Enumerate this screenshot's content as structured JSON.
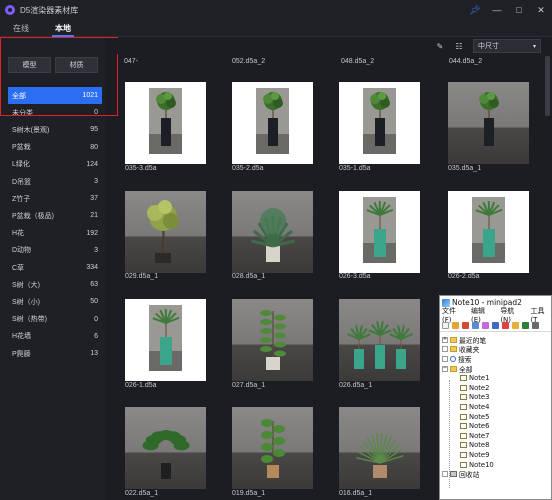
{
  "app": {
    "title": "D5渲染器素材库"
  },
  "tabs": [
    "在线",
    "本地"
  ],
  "type_buttons": [
    "模型",
    "材质"
  ],
  "categories": [
    {
      "label": "全部",
      "count": "1021"
    },
    {
      "label": "未分类",
      "count": "0"
    },
    {
      "label": "S树木(景观)",
      "count": "95"
    },
    {
      "label": "P盆栽",
      "count": "80"
    },
    {
      "label": "L绿化",
      "count": "124"
    },
    {
      "label": "D吊篮",
      "count": "3"
    },
    {
      "label": "Z竹子",
      "count": "37"
    },
    {
      "label": "P盆栽（极品)",
      "count": "21"
    },
    {
      "label": "H花",
      "count": "192"
    },
    {
      "label": "D动物",
      "count": "3"
    },
    {
      "label": "C草",
      "count": "334"
    },
    {
      "label": "S树（大)",
      "count": "63"
    },
    {
      "label": "S树（小)",
      "count": "50"
    },
    {
      "label": "S树（热带)",
      "count": "0"
    },
    {
      "label": "H花墙",
      "count": "6"
    },
    {
      "label": "P爬藤",
      "count": "13"
    }
  ],
  "toolbar": {
    "size_select": "中尺寸"
  },
  "top_labels": [
    "047-",
    "052.d5a_2",
    "048.d5a_2",
    "044.d5a_2"
  ],
  "items": [
    {
      "label": "035-3.d5a",
      "bg": "white",
      "plant": "topiary"
    },
    {
      "label": "035-2.d5a",
      "bg": "white",
      "plant": "topiary"
    },
    {
      "label": "035-1.d5a",
      "bg": "white",
      "plant": "topiary"
    },
    {
      "label": "035.d5a_1",
      "bg": "concrete",
      "plant": "topiary"
    },
    {
      "label": "029.d5a_1",
      "bg": "concrete",
      "plant": "bonsai"
    },
    {
      "label": "028.d5a_1",
      "bg": "concrete",
      "plant": "fern"
    },
    {
      "label": "026-3.d5a",
      "bg": "white",
      "plant": "palm"
    },
    {
      "label": "026-2.d5a",
      "bg": "white",
      "plant": "palm"
    },
    {
      "label": "026-1.d5a",
      "bg": "white",
      "plant": "palm"
    },
    {
      "label": "027.d5a_1",
      "bg": "concrete",
      "plant": "ficus"
    },
    {
      "label": "026.d5a_1",
      "bg": "concrete",
      "plant": "triple-palm"
    },
    {
      "label": "",
      "bg": "concrete",
      "plant": "none"
    },
    {
      "label": "022.d5a_1",
      "bg": "concrete",
      "plant": "monstera"
    },
    {
      "label": "019.d5a_1",
      "bg": "concrete",
      "plant": "rubber"
    },
    {
      "label": "016.d5a_1",
      "bg": "concrete",
      "plant": "grass"
    },
    {
      "label": "",
      "bg": "concrete",
      "plant": "none"
    }
  ],
  "minipad": {
    "title": "Note10 - minipad2",
    "menu": [
      "文件(F)",
      "编辑(E)",
      "导航(N)",
      "工具(T"
    ],
    "tree": [
      {
        "label": "最近的笔",
        "level": 0,
        "icon": "folder",
        "exp": "+"
      },
      {
        "label": "收藏夹",
        "level": 0,
        "icon": "folder",
        "exp": ""
      },
      {
        "label": "搜索",
        "level": 0,
        "icon": "search",
        "exp": ""
      },
      {
        "label": "全部",
        "level": 0,
        "icon": "folder",
        "exp": "−"
      },
      {
        "label": "Note1",
        "level": 1,
        "icon": "note",
        "exp": ""
      },
      {
        "label": "Note2",
        "level": 1,
        "icon": "note",
        "exp": ""
      },
      {
        "label": "Note3",
        "level": 1,
        "icon": "note",
        "exp": ""
      },
      {
        "label": "Note4",
        "level": 1,
        "icon": "note",
        "exp": ""
      },
      {
        "label": "Note5",
        "level": 1,
        "icon": "note",
        "exp": ""
      },
      {
        "label": "Note6",
        "level": 1,
        "icon": "note",
        "exp": ""
      },
      {
        "label": "Note7",
        "level": 1,
        "icon": "note",
        "exp": ""
      },
      {
        "label": "Note8",
        "level": 1,
        "icon": "note",
        "exp": ""
      },
      {
        "label": "Note9",
        "level": 1,
        "icon": "note",
        "exp": ""
      },
      {
        "label": "Note10",
        "level": 1,
        "icon": "note",
        "exp": ""
      },
      {
        "label": "回收站",
        "level": 0,
        "icon": "trash",
        "exp": ""
      }
    ]
  },
  "colors": {
    "accent": "#2c6ef2",
    "annotation": "#e0212a"
  }
}
